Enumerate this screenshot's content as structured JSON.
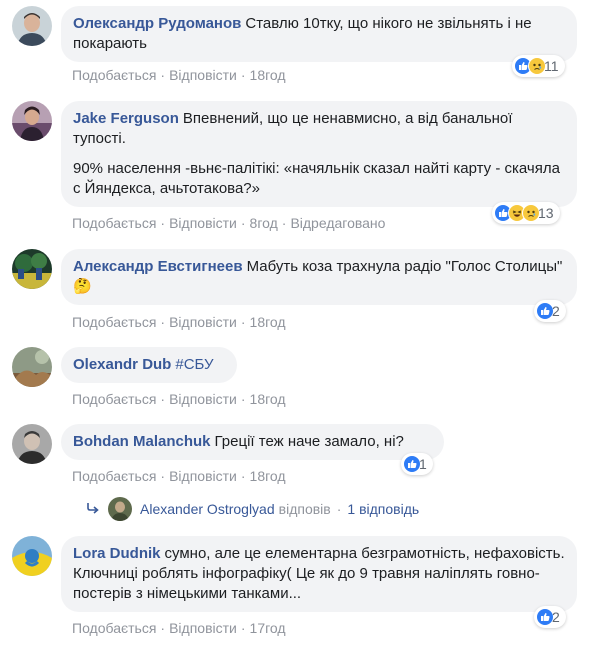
{
  "actions": {
    "like": "Подобається",
    "reply": "Відповісти",
    "sep": "·"
  },
  "comments": [
    {
      "author": "Олександр Рудоманов",
      "text": "Ставлю 10тку, що нікого не звільнять і не покарають",
      "time": "18год",
      "reactions": [
        "like-reaction-icon",
        "sad-reaction-icon"
      ],
      "count": "11"
    },
    {
      "author": "Jake Ferguson",
      "text": "Впевнений, що це ненавмисно, а від банальної тупості.",
      "text2": "90% населення -вьнє-палітікі: «начяльнік сказал найті карту - скачяла с Йяндекса, ачьтотакова?»",
      "time": "8год",
      "edited": "Відредаговано",
      "reactions": [
        "like-reaction-icon",
        "haha-reaction-icon",
        "sad-reaction-icon"
      ],
      "count": "13"
    },
    {
      "author": "Александр Евстигнеев",
      "text": "Мабуть коза трахнула радіо \"Голос Столицы\"",
      "emoji": "🤔",
      "time": "18год",
      "reactions": [
        "like-reaction-icon"
      ],
      "count": "2"
    },
    {
      "author": "Olexandr Dub",
      "text": "#СБУ",
      "time": "18год"
    },
    {
      "author": "Bohdan Malanchuk",
      "text": "Греції теж наче замало, ні?",
      "time": "18год",
      "reactions": [
        "like-reaction-icon"
      ],
      "count": "1"
    },
    {
      "author": "Lora Dudnik",
      "text": "сумно, але це елементарна безграмотність, нефаховість. Ключниці роблять інфографіку( Це як до 9 травня наліплять говно-постерів з німецькими танками...",
      "time": "17год",
      "reactions": [
        "like-reaction-icon"
      ],
      "count": "2"
    }
  ],
  "reply_thread": {
    "name": "Alexander Ostroglyad",
    "verb": "відповів",
    "sep": "·",
    "count": "1 відповідь"
  },
  "colors": {
    "link": "#385898",
    "bubble": "#f2f3f5",
    "meta": "#90949c",
    "like": "#2e7cf6",
    "emoji": "#f7c83c"
  }
}
